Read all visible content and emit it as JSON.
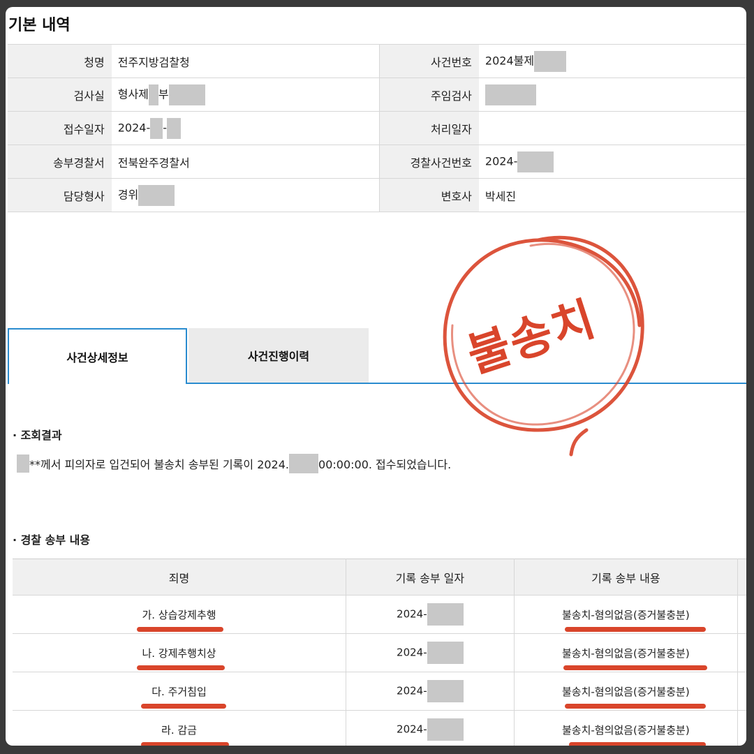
{
  "basic_info": {
    "title": "기본 내역",
    "rows": [
      {
        "l1": "청명",
        "v1": "전주지방검찰청",
        "l2": "사건번호",
        "v2": "2024불제"
      },
      {
        "l1": "검사실",
        "v1": "형사제",
        "v1b": "부",
        "l2": "주임검사",
        "v2": ""
      },
      {
        "l1": "접수일자",
        "v1": "2024-",
        "v1b": "-",
        "l2": "처리일자",
        "v2": ""
      },
      {
        "l1": "송부경찰서",
        "v1": "전북완주경찰서",
        "l2": "경찰사건번호",
        "v2": "2024-"
      },
      {
        "l1": "담당형사",
        "v1": "경위",
        "l2": "변호사",
        "v2": "박세진"
      }
    ]
  },
  "tabs": {
    "active": "사건상세정보",
    "inactive": "사건진행이력"
  },
  "stamp": {
    "text": "불송치",
    "color": "#d9452b"
  },
  "result": {
    "heading": "조회결과",
    "text_a": "**께서 피의자로 입건되어 불송치 송부된 기록이 2024.",
    "text_b": "00:00:00. 접수되었습니다."
  },
  "police": {
    "heading": "경찰 송부 내용",
    "columns": [
      "죄명",
      "기록 송부 일자",
      "기록 송부 내용"
    ],
    "rows": [
      {
        "crime": "가. 상습강제추행",
        "date": "2024-",
        "content": "불송치-혐의없음(증거불충분)"
      },
      {
        "crime": "나. 강제추행치상",
        "date": "2024-",
        "content": "불송치-혐의없음(증거불충분)"
      },
      {
        "crime": "다. 주거침입",
        "date": "2024-",
        "content": "불송치-혐의없음(증거불충분)"
      },
      {
        "crime": "라. 감금",
        "date": "2024-",
        "content": "불송치-혐의없음(증거불충분)"
      }
    ]
  },
  "colors": {
    "accent_blue": "#2a8ccf",
    "highlight_red": "#d9452b",
    "mask_gray": "#c8c8c8"
  }
}
